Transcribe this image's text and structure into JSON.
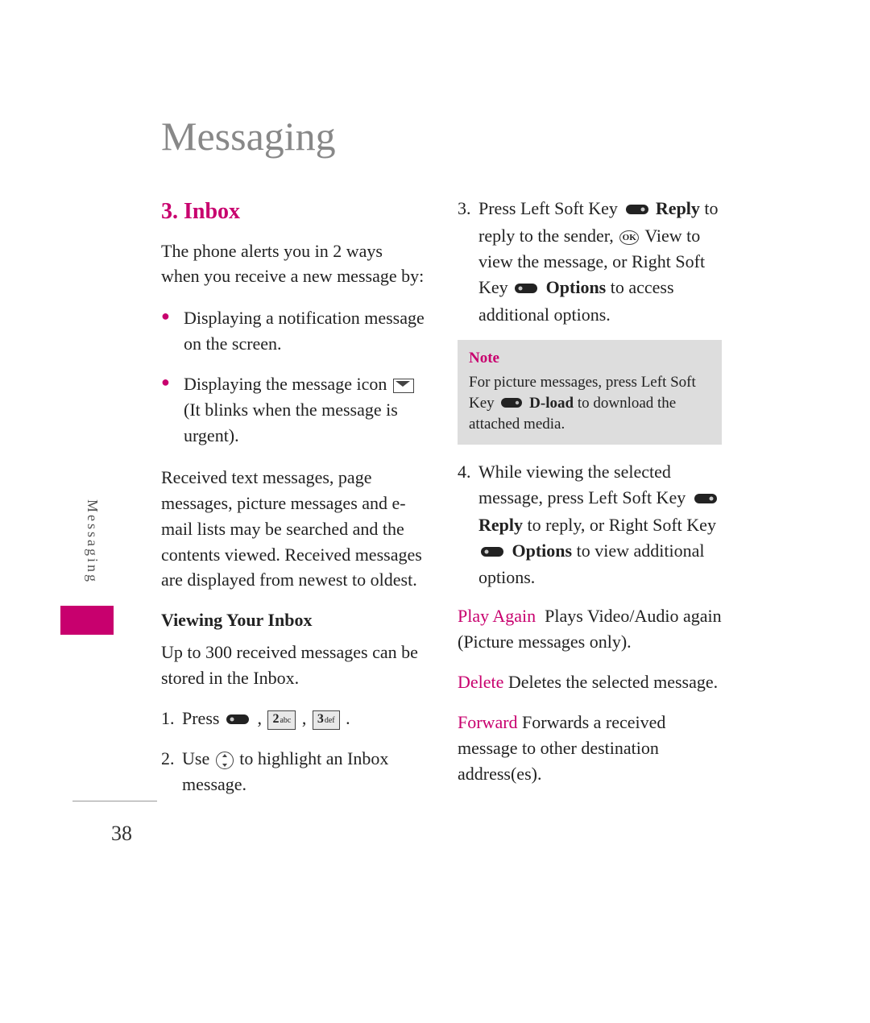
{
  "page": {
    "title": "Messaging",
    "side_label": "Messaging",
    "page_number": "38"
  },
  "left": {
    "section_number": "3.",
    "section_title": "Inbox",
    "intro": "The phone alerts you in 2 ways when you receive a new message by:",
    "bullet1": "Displaying a notification message on the screen.",
    "bullet2a": "Displaying the message icon",
    "bullet2b": "(It blinks when the message is urgent).",
    "para2": "Received text messages, page messages, picture messages and e-mail lists may be searched and the contents viewed. Received messages are displayed from newest to oldest.",
    "subhead": "Viewing Your Inbox",
    "capacity": "Up to 300 received messages can be stored in the Inbox.",
    "step1_pre": "Press",
    "key2": {
      "digit": "2",
      "letters": "abc"
    },
    "key3": {
      "digit": "3",
      "letters": "def"
    },
    "step2_pre": "Use",
    "step2_post": "to highlight an Inbox message."
  },
  "right": {
    "step3_a": "Press Left Soft Key",
    "step3_reply": "Reply",
    "step3_b": "to reply to the sender,",
    "step3_c": "View to view the message, or Right Soft Key",
    "step3_options": "Options",
    "step3_d": "to access additional options.",
    "note_title": "Note",
    "note_a": "For picture messages, press Left Soft Key",
    "note_dload": "D-load",
    "note_b": "to download the attached media.",
    "step4_a": "While viewing the selected message, press Left Soft Key",
    "step4_reply": "Reply",
    "step4_b": "to reply, or Right Soft Key",
    "step4_options": "Options",
    "step4_c": "to view additional options.",
    "play_label": "Play Again",
    "play_text": "Plays Video/Audio again (Picture messages only).",
    "delete_label": "Delete",
    "delete_text": "Deletes the selected message.",
    "forward_label": "Forward",
    "forward_text": "Forwards a received message to other destination address(es)."
  }
}
